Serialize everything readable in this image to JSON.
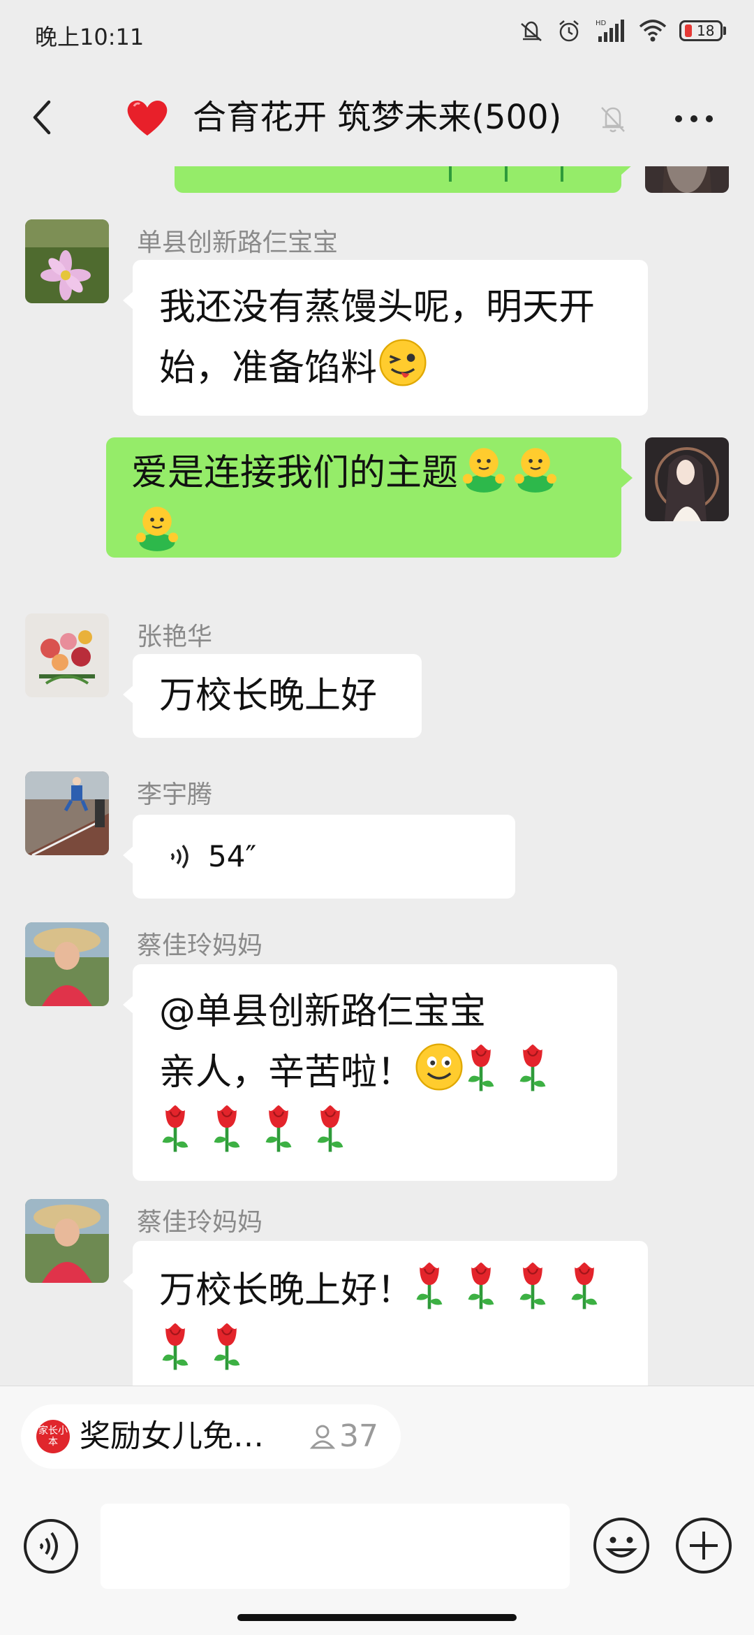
{
  "status": {
    "time": "晚上10:11",
    "battery": "18",
    "network_badge": "HD"
  },
  "header": {
    "title": "合育花开 筑梦未来(500)"
  },
  "messages": [
    {
      "sender": "单县创新路仨宝宝",
      "line1": "我还没有蒸馒头呢，明天开",
      "line2": "始，准备馅料"
    },
    {
      "line1": "爱是连接我们的主题"
    },
    {
      "sender": "张艳华",
      "text": "万校长晚上好"
    },
    {
      "sender": "李宇腾",
      "duration": "54″"
    },
    {
      "sender": "蔡佳玲妈妈",
      "line1": "@单县创新路仨宝宝",
      "line2": " 亲人，辛苦啦！"
    },
    {
      "sender": "蔡佳玲妈妈",
      "line1": "万校长晚上好！"
    }
  ],
  "quote_chip": {
    "logo_text": "家长小本",
    "text": "奖励女儿免…",
    "count": "37"
  },
  "colors": {
    "outgoing_bubble": "#95ec69",
    "incoming_bubble": "#ffffff",
    "background": "#ededed"
  },
  "icons": [
    "back-icon",
    "heart-icon",
    "mute-icon",
    "more-icon",
    "voice-icon",
    "smile-emoji-icon",
    "tongue-emoji-icon",
    "rose-icon",
    "voice-input-icon",
    "emoji-icon",
    "plus-icon",
    "person-icon"
  ]
}
